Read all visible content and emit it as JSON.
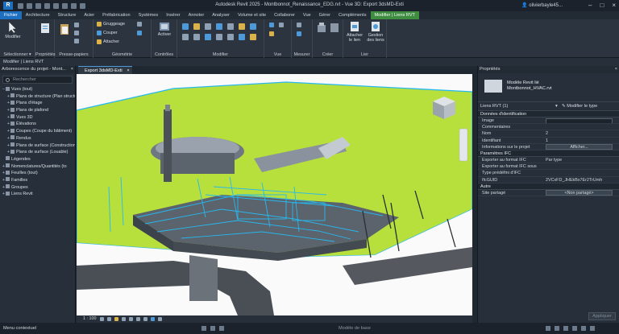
{
  "titlebar": {
    "app_title": "Autodesk Revit 2025 - Montbonnot_Renaissance_EDG.rvt - Vue 3D: Export 3dsMD-Exti",
    "user": "olivierbayle45...",
    "logo_letter": "R"
  },
  "tabs": [
    "Fichier",
    "Architecture",
    "Structure",
    "Acier",
    "Préfabrication",
    "Systèmes",
    "Insérer",
    "Annoter",
    "Analyser",
    "Volume et site",
    "Collaborer",
    "Vue",
    "Gérer",
    "Compléments",
    "Modifier | Liens RVT"
  ],
  "ribbon": {
    "modify_label": "Modifier",
    "select_label": "Sélectionner ▾",
    "properties_label": "Propriétés",
    "clipboard_label": "Presse-papiers",
    "geometry": {
      "items": [
        "Gruggeage",
        "Couper",
        "Attacher"
      ],
      "label": "Géométrie"
    },
    "controls": {
      "activate_label": "Activer",
      "label": "Contrôles"
    },
    "modify_group_label": "Modifier",
    "view_group_label": "Vue",
    "measure_group_label": "Mesurer",
    "create_group_label": "Créer",
    "link": {
      "attach_label": "Attacher le lien",
      "manage_label": "Gestion des liens",
      "label": "Lier"
    }
  },
  "optbar": {
    "text": "Modifier | Liens RVT"
  },
  "browser": {
    "title": "Arborescence du projet - Mont...",
    "search_placeholder": "Rechercher",
    "nodes": [
      {
        "toggle": "−",
        "label": "Vues (tout)",
        "indent": 0
      },
      {
        "toggle": "+",
        "label": "Plans de structure (Plan structu",
        "indent": 1
      },
      {
        "toggle": "+",
        "label": "Plans d'étage",
        "indent": 1
      },
      {
        "toggle": "+",
        "label": "Plans de plafond",
        "indent": 1
      },
      {
        "toggle": "+",
        "label": "Vues 3D",
        "indent": 1
      },
      {
        "toggle": "+",
        "label": "Élévations",
        "indent": 1
      },
      {
        "toggle": "+",
        "label": "Coupes (Coupe du bâtiment)",
        "indent": 1
      },
      {
        "toggle": "+",
        "label": "Rendus",
        "indent": 1
      },
      {
        "toggle": "+",
        "label": "Plans de surface (Construction",
        "indent": 1
      },
      {
        "toggle": "+",
        "label": "Plans de surface (Louable)",
        "indent": 1
      },
      {
        "toggle": "",
        "label": "Légendes",
        "indent": 0
      },
      {
        "toggle": "+",
        "label": "Nomenclatures/Quantités (to",
        "indent": 0
      },
      {
        "toggle": "+",
        "label": "Feuilles (tout)",
        "indent": 0
      },
      {
        "toggle": "+",
        "label": "Familles",
        "indent": 0
      },
      {
        "toggle": "+",
        "label": "Groupes",
        "indent": 0
      },
      {
        "toggle": "+",
        "label": "Liens Revit",
        "indent": 0
      }
    ]
  },
  "view": {
    "tab_title": "Export 3dsMD-Exti",
    "scale": "1 : 100",
    "ground_color": "#b7e03c",
    "selection_color": "#27b8ef"
  },
  "properties": {
    "title": "Propriétés",
    "type_name_1": "Modèle Revit lié",
    "type_name_2": "Montbonnot_HVAC.rvt",
    "instance_filter": "Liens RVT (1)",
    "edit_type": "Modifier le type",
    "sections": [
      {
        "name": "Données d'identification",
        "rows": [
          {
            "key": "Image",
            "value": "",
            "style": "box"
          },
          {
            "key": "Commentaires",
            "value": "",
            "style": ""
          },
          {
            "key": "Nom",
            "value": "2",
            "style": ""
          },
          {
            "key": "Identifiant",
            "value": "1",
            "style": ""
          },
          {
            "key": "Informations sur le projet",
            "value": "Afficher...",
            "style": "btn"
          }
        ]
      },
      {
        "name": "Paramètres IFC",
        "rows": [
          {
            "key": "Exporter au format IFC",
            "value": "Par type",
            "style": ""
          },
          {
            "key": "Exporter au format IFC sous",
            "value": "",
            "style": ""
          },
          {
            "key": "Type prédéfini d'IFC",
            "value": "",
            "style": ""
          },
          {
            "key": "IfcGUID",
            "value": "2VCxFD_JHEkBx7Er2TrUmh",
            "style": ""
          }
        ]
      },
      {
        "name": "Autre",
        "rows": [
          {
            "key": "Site partagé",
            "value": "<Non partagé>",
            "style": "btn"
          }
        ]
      }
    ],
    "apply": "Appliquer"
  },
  "statusbar": {
    "context": "Menu contextuel",
    "model": "Modèle de base"
  }
}
